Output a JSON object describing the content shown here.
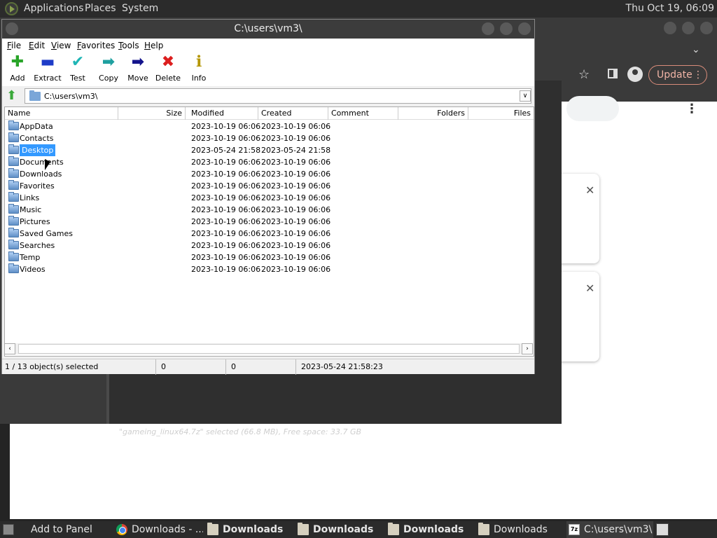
{
  "top_panel": {
    "menus": [
      "Applications",
      "Places",
      "System"
    ],
    "clock": "Thu Oct 19, 06:09"
  },
  "chrome": {
    "update_label": "Update",
    "kebab": "⋮"
  },
  "fm_status": "\"gameing_linux64.7z\" selected (66.8 MB), Free space: 33.7 GB",
  "zip": {
    "title": "C:\\users\\vm3\\",
    "menu": [
      {
        "u": "F",
        "rest": "ile"
      },
      {
        "u": "E",
        "rest": "dit"
      },
      {
        "u": "V",
        "rest": "iew"
      },
      {
        "u": "F",
        "rest": "avorites"
      },
      {
        "u": "T",
        "rest": "ools"
      },
      {
        "u": "H",
        "rest": "elp"
      }
    ],
    "toolbar": {
      "add": "Add",
      "extract": "Extract",
      "test": "Test",
      "copy": "Copy",
      "move": "Move",
      "delete": "Delete",
      "info": "Info"
    },
    "path": "C:\\users\\vm3\\",
    "columns": {
      "name": "Name",
      "size": "Size",
      "modified": "Modified",
      "created": "Created",
      "comment": "Comment",
      "folders": "Folders",
      "files": "Files"
    },
    "rows": [
      {
        "name": "AppData",
        "modified": "2023-10-19 06:06",
        "created": "2023-10-19 06:06"
      },
      {
        "name": "Contacts",
        "modified": "2023-10-19 06:06",
        "created": "2023-10-19 06:06"
      },
      {
        "name": "Desktop",
        "modified": "2023-05-24 21:58",
        "created": "2023-05-24 21:58"
      },
      {
        "name": "Documents",
        "modified": "2023-10-19 06:06",
        "created": "2023-10-19 06:06"
      },
      {
        "name": "Downloads",
        "modified": "2023-10-19 06:06",
        "created": "2023-10-19 06:06"
      },
      {
        "name": "Favorites",
        "modified": "2023-10-19 06:06",
        "created": "2023-10-19 06:06"
      },
      {
        "name": "Links",
        "modified": "2023-10-19 06:06",
        "created": "2023-10-19 06:06"
      },
      {
        "name": "Music",
        "modified": "2023-10-19 06:06",
        "created": "2023-10-19 06:06"
      },
      {
        "name": "Pictures",
        "modified": "2023-10-19 06:06",
        "created": "2023-10-19 06:06"
      },
      {
        "name": "Saved Games",
        "modified": "2023-10-19 06:06",
        "created": "2023-10-19 06:06"
      },
      {
        "name": "Searches",
        "modified": "2023-10-19 06:06",
        "created": "2023-10-19 06:06"
      },
      {
        "name": "Temp",
        "modified": "2023-10-19 06:06",
        "created": "2023-10-19 06:06"
      },
      {
        "name": "Videos",
        "modified": "2023-10-19 06:06",
        "created": "2023-10-19 06:06"
      }
    ],
    "selected_index": 2,
    "status": {
      "selection": "1 / 13 object(s) selected",
      "size": "0",
      "packed": "0",
      "date": "2023-05-24 21:58:23"
    }
  },
  "taskbar": {
    "items": [
      {
        "label": "Add to Panel",
        "icon": "panel-icon"
      },
      {
        "label": "Downloads - ...",
        "icon": "chrome-icon"
      },
      {
        "label": "Downloads",
        "icon": "folder-icon"
      },
      {
        "label": "Downloads",
        "icon": "folder-icon"
      },
      {
        "label": "Downloads",
        "icon": "folder-icon"
      },
      {
        "label": "Downloads",
        "icon": "folder-icon"
      },
      {
        "label": "C:\\users\\vm3\\",
        "icon": "7zip-icon"
      }
    ]
  },
  "colors": {
    "selection": "#3399ff",
    "panel": "#2b2b2b",
    "update_accent": "#f1b4a6"
  }
}
